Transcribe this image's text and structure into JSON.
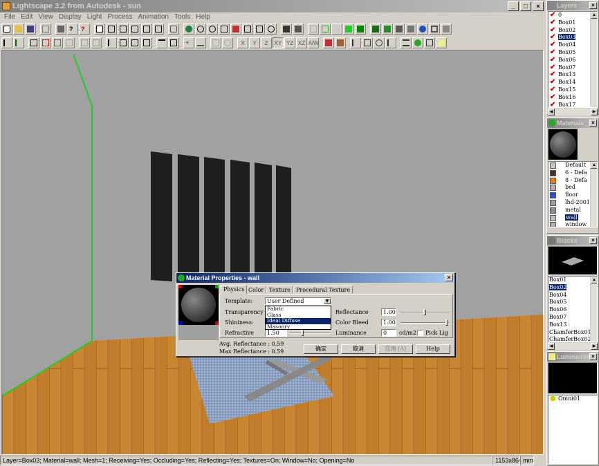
{
  "app": {
    "title": "Lightscape 3.2 from Autodesk - sun",
    "window_buttons": [
      "_",
      "□",
      "×"
    ]
  },
  "menubar": [
    "File",
    "Edit",
    "View",
    "Display",
    "Light",
    "Process",
    "Animation",
    "Tools",
    "Help"
  ],
  "toolbar2_text_buttons": [
    "X",
    "Y",
    "Z",
    "XY",
    "YZ",
    "XZ",
    "A/W"
  ],
  "status": {
    "info": "Layer=Box03; Material=wall; Mesh=1; Receiving=Yes; Occluding=Yes; Reflecting=Yes; Textures=On; Window=No; Opening=No",
    "resolution": "1153x866",
    "unit": "mm"
  },
  "layers_panel": {
    "title": "Layers",
    "items": [
      {
        "label": "0",
        "checked": true
      },
      {
        "label": "Box01",
        "checked": true
      },
      {
        "label": "Box02",
        "checked": true
      },
      {
        "label": "Box03",
        "checked": true,
        "selected": true
      },
      {
        "label": "Box04",
        "checked": true
      },
      {
        "label": "Box05",
        "checked": true
      },
      {
        "label": "Box06",
        "checked": true
      },
      {
        "label": "Box07",
        "checked": true
      },
      {
        "label": "Box13",
        "checked": true
      },
      {
        "label": "Box14",
        "checked": true
      },
      {
        "label": "Box15",
        "checked": true
      },
      {
        "label": "Box16",
        "checked": true
      },
      {
        "label": "Box17",
        "checked": true
      }
    ]
  },
  "materials_panel": {
    "title": "Materials",
    "items": [
      {
        "label": "Default",
        "color": "#c8c8c8"
      },
      {
        "label": "6 - Defa",
        "color": "#4a3020"
      },
      {
        "label": "8 - Defa",
        "color": "#e08020"
      },
      {
        "label": "bed",
        "color": "#b0b0b0"
      },
      {
        "label": "floor",
        "color": "#3050c0"
      },
      {
        "label": "lhd-2001",
        "color": "#a0a0a0"
      },
      {
        "label": "metal",
        "color": "#909090"
      },
      {
        "label": "wall",
        "color": "#c0c0c0",
        "selected": true
      },
      {
        "label": "window",
        "color": "#b0b0b0"
      }
    ]
  },
  "blocks_panel": {
    "title": "Blocks",
    "items": [
      {
        "label": "Box01"
      },
      {
        "label": "Box02",
        "selected": true
      },
      {
        "label": "Box04"
      },
      {
        "label": "Box05"
      },
      {
        "label": "Box06"
      },
      {
        "label": "Box07"
      },
      {
        "label": "Box13"
      },
      {
        "label": "ChamferBox01"
      },
      {
        "label": "ChamferBox02"
      }
    ]
  },
  "luminaires_panel": {
    "title": "Luminaires",
    "items": [
      {
        "label": "Omni01"
      }
    ]
  },
  "material_dialog": {
    "title": "Material Properties - wall",
    "tabs": [
      "Physics",
      "Color",
      "Texture",
      "Procedural Texture"
    ],
    "template_label": "Template:",
    "template_value": "User Defined",
    "template_options": [
      "Fabric",
      "Glass",
      "Ideal Diffuse",
      "Masonry"
    ],
    "template_selected": "Ideal Diffuse",
    "transparency_label": "Transparency",
    "shininess_label": "Shininess:",
    "refractive_label": "Refractive",
    "refractive_value": "1.50",
    "reflectance_label": "Reflectance",
    "reflectance_value": "1.00",
    "color_bleed_label": "Color Bleed",
    "color_bleed_value": "1.00",
    "luminance_label": "Luminance",
    "luminance_value": "0",
    "luminance_unit": "cd/m2",
    "pick_label": "Pick Lig",
    "avg_reflectance": "Avg. Reflectance : 0.59",
    "max_reflectance": "Max Reflectance : 0.59",
    "ok_label": "确定",
    "cancel_label": "取消",
    "apply_label": "应用 (A)",
    "help_label": "Help"
  }
}
